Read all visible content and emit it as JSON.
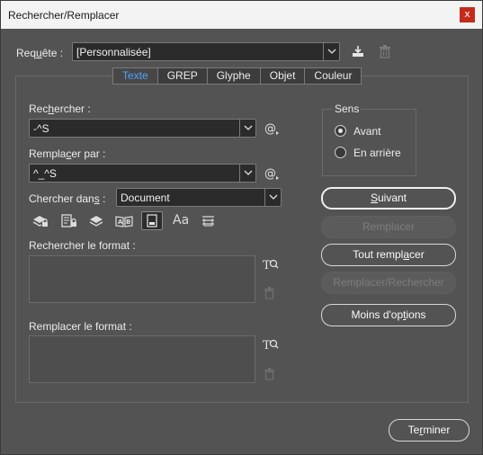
{
  "window": {
    "title": "Rechercher/Remplacer",
    "close_label": "x"
  },
  "query": {
    "label_pre": "Req",
    "label_u": "u",
    "label_post": "ête :",
    "value": "[Personnalisée]"
  },
  "tabs": [
    {
      "label": "Texte",
      "active": true
    },
    {
      "label": "GREP",
      "active": false
    },
    {
      "label": "Glyphe",
      "active": false
    },
    {
      "label": "Objet",
      "active": false
    },
    {
      "label": "Couleur",
      "active": false
    }
  ],
  "search": {
    "label_pre": "Rec",
    "label_u": "h",
    "label_post": "ercher :",
    "value": "-^S"
  },
  "replace": {
    "label_pre": "Rempla",
    "label_u": "c",
    "label_post": "er par :",
    "value": "^_^S"
  },
  "scope": {
    "label_pre": "Chercher dan",
    "label_u": "s",
    "label_post": " :",
    "value": "Document"
  },
  "options_icons": [
    "locked-layers-icon",
    "locked-stories-icon",
    "hidden-layers-icon",
    "master-pages-icon",
    "footnotes-icon",
    "case-sensitive-icon",
    "whole-word-icon"
  ],
  "case_icon_text": "Aa",
  "find_format": {
    "label": "Rechercher le format :"
  },
  "replace_format": {
    "label": "Remplacer le format :"
  },
  "direction": {
    "legend": "Sens",
    "options": [
      {
        "label": "Avant",
        "selected": true
      },
      {
        "label": "En arrière",
        "selected": false
      }
    ]
  },
  "buttons": {
    "next_pre": "",
    "next_u": "S",
    "next_post": "uivant",
    "replace": "Remplacer",
    "replace_all_pre": "Tout rempl",
    "replace_all_u": "a",
    "replace_all_post": "cer",
    "replace_find": "Remplacer/Rechercher",
    "fewer_pre": "Moins d'op",
    "fewer_u": "t",
    "fewer_post": "ions",
    "done_pre": "Te",
    "done_u": "r",
    "done_post": "miner"
  },
  "colors": {
    "accent": "#4ea3ff",
    "panel": "#535353",
    "field": "#2b2b2b",
    "close": "#c42b1c"
  }
}
